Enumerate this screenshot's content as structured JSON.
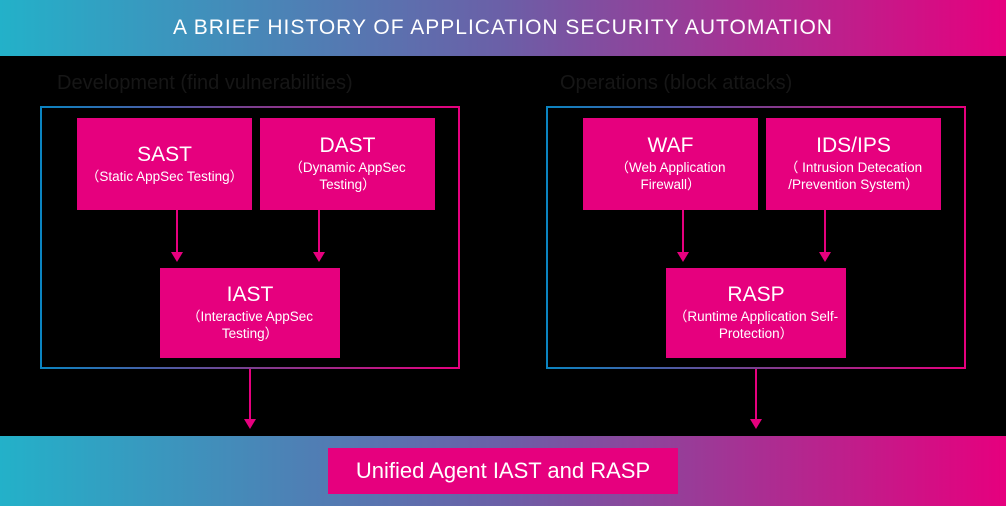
{
  "header": {
    "title": "A BRIEF HISTORY OF APPLICATION SECURITY AUTOMATION"
  },
  "sections": {
    "dev": {
      "label": "Development (find vulnerabilities)",
      "top": [
        {
          "title": "SAST",
          "sub": "（Static  AppSec Testing）"
        },
        {
          "title": "DAST",
          "sub": "（Dynamic  AppSec Testing）"
        }
      ],
      "mid": {
        "title": "IAST",
        "sub": "（Interactive AppSec Testing）"
      }
    },
    "ops": {
      "label": "Operations (block attacks)",
      "top": [
        {
          "title": "WAF",
          "sub": "（Web Application Firewall）"
        },
        {
          "title": "IDS/IPS",
          "sub": "（ Intrusion Detecation /Prevention System）"
        }
      ],
      "mid": {
        "title": "RASP",
        "sub": "（Runtime  Application Self-Protection）"
      }
    }
  },
  "unified": {
    "label": "Unified Agent IAST and RASP"
  }
}
